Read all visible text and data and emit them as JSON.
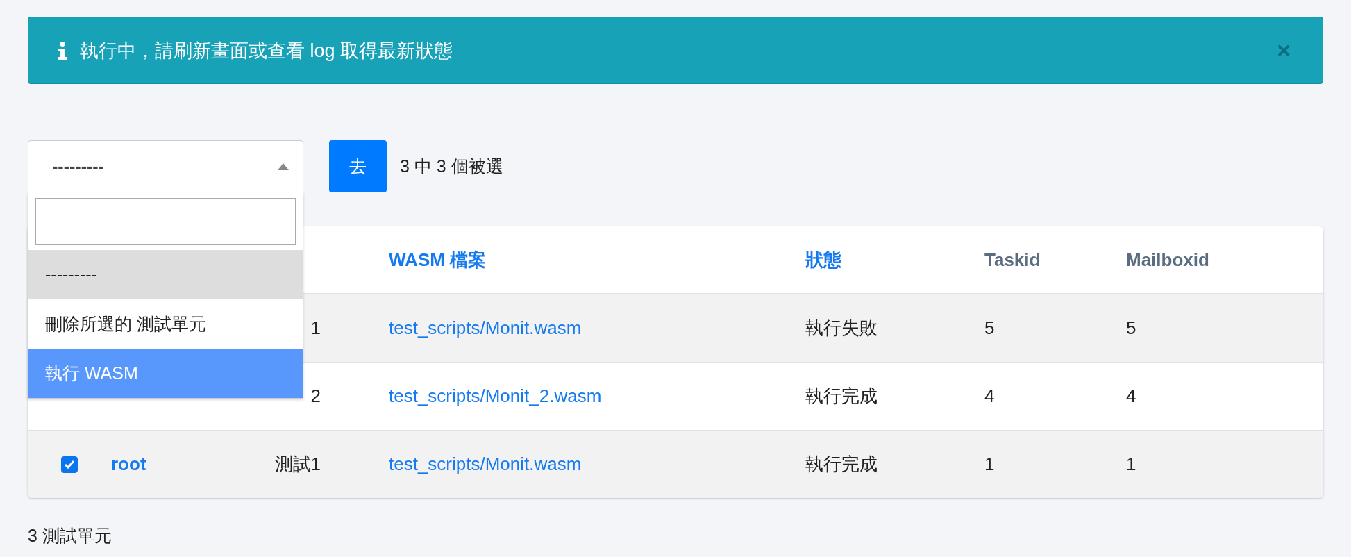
{
  "alert": {
    "message": "執行中，請刷新畫面或查看 log 取得最新狀態",
    "close": "×"
  },
  "action_select": {
    "value": "---------",
    "expanded": true,
    "options": [
      {
        "label": "---------",
        "selected": true,
        "highlighted": false
      },
      {
        "label": "刪除所選的 測試單元",
        "selected": false,
        "highlighted": false
      },
      {
        "label": "執行 WASM",
        "selected": false,
        "highlighted": true
      }
    ]
  },
  "go_button": "去",
  "selection_count": "3 中 3 個被選",
  "table": {
    "columns": [
      {
        "label": "WASM 檔案",
        "kind": "link"
      },
      {
        "label": "狀態",
        "kind": "link"
      },
      {
        "label": "Taskid",
        "kind": "plain"
      },
      {
        "label": "Mailboxid",
        "kind": "plain"
      }
    ],
    "rows": [
      {
        "name": "1",
        "wasm": "test_scripts/Monit.wasm",
        "status": "執行失敗",
        "taskid": "5",
        "mailboxid": "5"
      },
      {
        "name": "2",
        "wasm": "test_scripts/Monit_2.wasm",
        "status": "執行完成",
        "taskid": "4",
        "mailboxid": "4"
      },
      {
        "checked": true,
        "user": "root",
        "name": "測試1",
        "wasm": "test_scripts/Monit.wasm",
        "status": "執行完成",
        "taskid": "1",
        "mailboxid": "1"
      }
    ]
  },
  "footer": "3 測試單元"
}
